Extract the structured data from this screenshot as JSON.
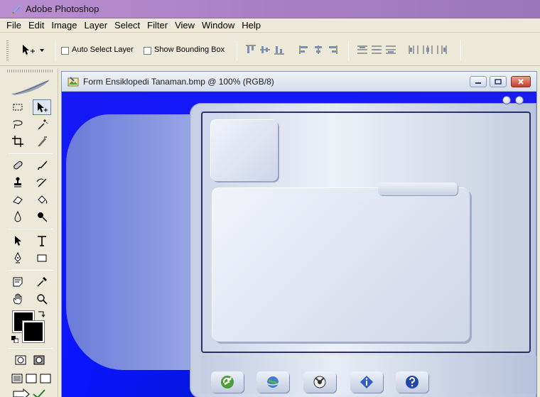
{
  "app": {
    "title": "Adobe Photoshop"
  },
  "menu": [
    "File",
    "Edit",
    "Image",
    "Layer",
    "Select",
    "Filter",
    "View",
    "Window",
    "Help"
  ],
  "options": {
    "auto_select_label": "Auto Select Layer",
    "auto_select_checked": false,
    "bounding_box_label": "Show Bounding Box",
    "bounding_box_checked": false
  },
  "document": {
    "title": "Form Ensiklopedi Tanaman.bmp @ 100% (RGB/8)"
  },
  "colors": {
    "titlebar": "#a97fc4",
    "canvas_blue": "#0a14ff",
    "foreground": "#000000",
    "background": "#000000"
  },
  "icons": {
    "nav_buttons": [
      "refresh-icon",
      "globe-icon",
      "media-icon",
      "info-icon",
      "help-icon"
    ]
  }
}
